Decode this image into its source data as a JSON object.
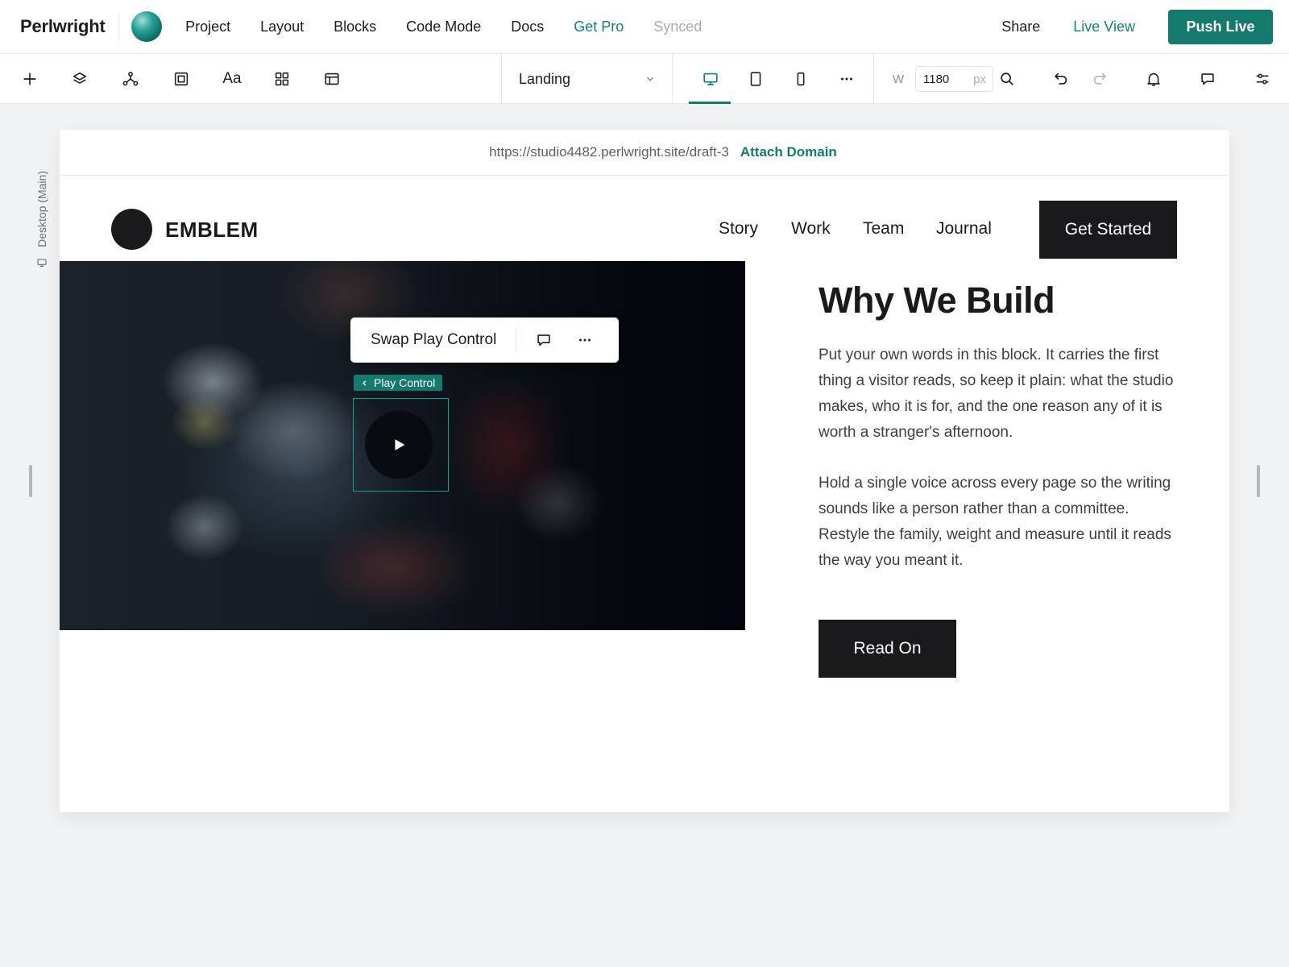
{
  "app": {
    "brand": "Perlwright",
    "menu": [
      "Project",
      "Layout",
      "Blocks",
      "Code Mode",
      "Docs",
      "Get Pro",
      "Synced"
    ],
    "share_label": "Share",
    "live_view_label": "Live View",
    "push_live_label": "Push Live",
    "accent_color": "#157a6e"
  },
  "toolbar": {
    "tools": [
      "add-icon",
      "layers-icon",
      "components-icon",
      "frame-icon",
      "typography-icon",
      "grid-icon",
      "template-icon"
    ],
    "typography_glyph": "Aa",
    "page_selected": "Landing",
    "devices": [
      "desktop-icon",
      "tablet-icon",
      "mobile-icon",
      "more-icon"
    ],
    "active_device": "desktop",
    "width_label": "W",
    "width_value": "1180",
    "width_unit": "px",
    "actions": [
      "search-icon",
      "undo-icon",
      "redo-icon",
      "bell-icon",
      "comment-icon",
      "settings-sliders-icon"
    ]
  },
  "canvas": {
    "breakpoint_label": "Desktop (Main)",
    "url": "https://studio4482.perlwright.site/draft-3",
    "attach_domain_label": "Attach Domain"
  },
  "site": {
    "name": "EMBLEM",
    "nav": [
      "Story",
      "Work",
      "Team",
      "Journal"
    ],
    "cta_label": "Get Started",
    "heading": "Why We Build",
    "paragraph_1": "Put your own words in this block. It carries the first thing a visitor reads, so keep it plain: what the studio makes, who it is for, and the one reason any of it is worth a stranger's afternoon.",
    "paragraph_2": "Hold a single voice across every page so the writing sounds like a person rather than a committee. Restyle the family, weight and measure until it reads the way you meant it.",
    "read_on_label": "Read On"
  },
  "selection": {
    "toolbar_label": "Swap Play Control",
    "tag_label": "Play Control"
  }
}
